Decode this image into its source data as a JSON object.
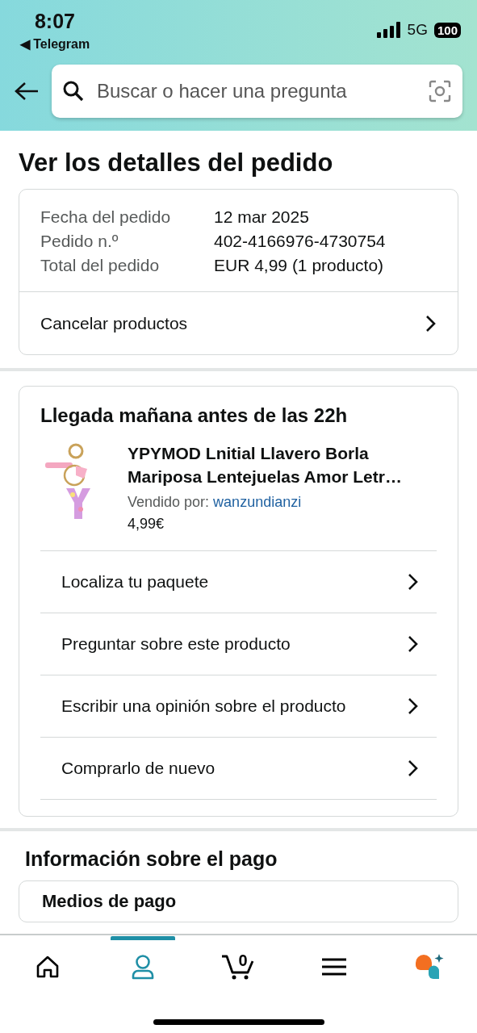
{
  "status_bar": {
    "time": "8:07",
    "back_app": "◀ Telegram",
    "network": "5G",
    "battery": "100"
  },
  "search": {
    "placeholder": "Buscar o hacer una pregunta"
  },
  "page_title": "Ver los detalles del pedido",
  "order_summary": {
    "rows": [
      {
        "label": "Fecha del pedido",
        "value": "12 mar 2025"
      },
      {
        "label": "Pedido n.º",
        "value": "402-4166976-4730754"
      },
      {
        "label": "Total del pedido",
        "value": "EUR 4,99 (1 producto)"
      }
    ],
    "action": "Cancelar productos"
  },
  "shipment": {
    "title": "Llegada mañana antes de las 22h",
    "product": {
      "name": "YPYMOD Lnitial Llavero Borla Mariposa Lentejuelas Amor Letr…",
      "sold_by_label": "Vendido por:",
      "seller": "wanzundianzi",
      "price": "4,99€"
    },
    "actions": [
      "Localiza tu paquete",
      "Preguntar sobre este producto",
      "Escribir una opinión sobre el producto",
      "Comprarlo de nuevo"
    ]
  },
  "payment": {
    "title": "Información sobre el pago",
    "card_title": "Medios de pago"
  },
  "bottom_nav": [
    {
      "kind": "home",
      "selected": false
    },
    {
      "kind": "account",
      "selected": true
    },
    {
      "kind": "cart",
      "count": "0",
      "selected": false
    },
    {
      "kind": "menu",
      "selected": false
    },
    {
      "kind": "assistant",
      "selected": false
    }
  ]
}
